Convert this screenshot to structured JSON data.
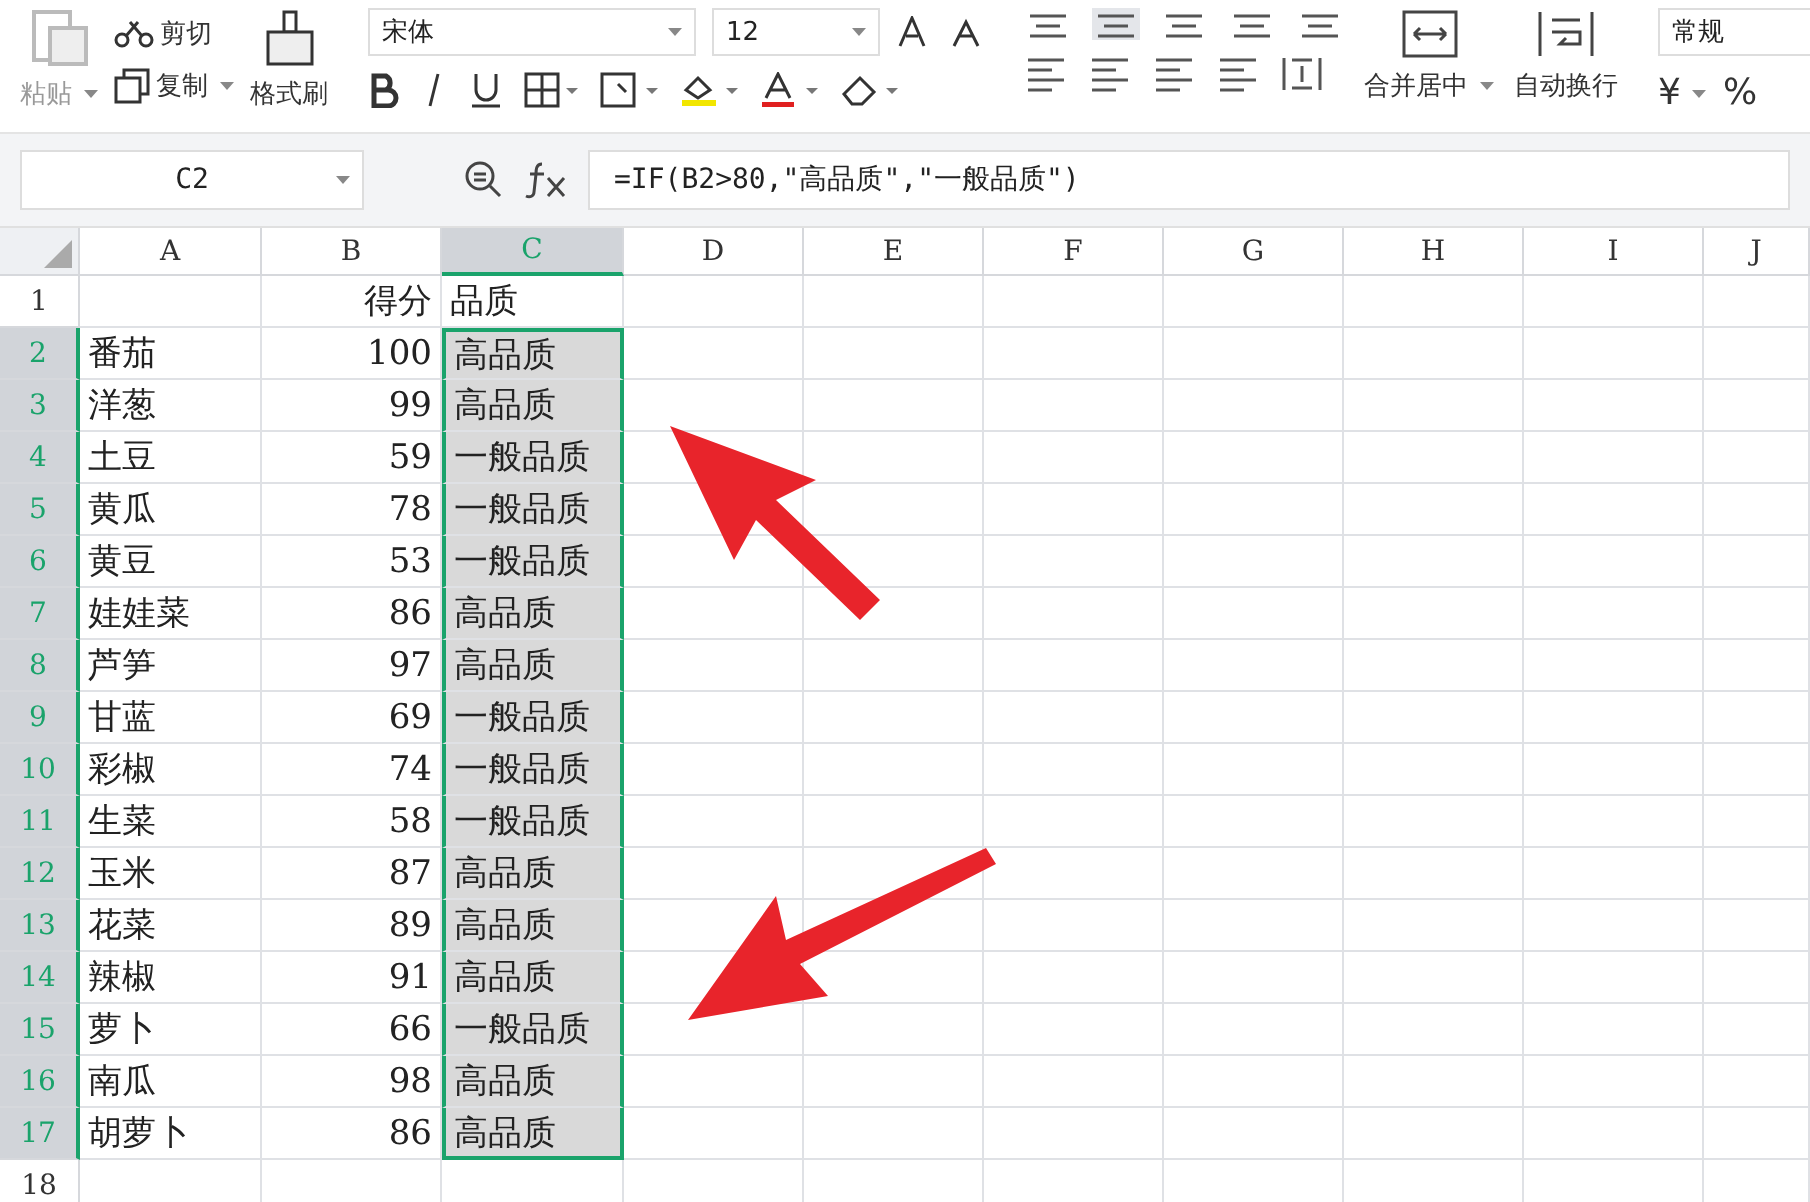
{
  "toolbar": {
    "paste": "粘贴",
    "cut": "剪切",
    "copy": "复制",
    "format_painter": "格式刷",
    "font_name": "宋体",
    "font_size": "12",
    "merge": "合并居中",
    "wrap": "自动换行",
    "number_format": "常规",
    "currency": "¥",
    "percent": "%"
  },
  "formula_bar": {
    "name_box": "C2",
    "formula": "=IF(B2>80,\"高品质\",\"一般品质\")"
  },
  "columns": [
    {
      "label": "A",
      "selected": false
    },
    {
      "label": "B",
      "selected": false
    },
    {
      "label": "C",
      "selected": true
    },
    {
      "label": "D",
      "selected": false
    },
    {
      "label": "E",
      "selected": false
    },
    {
      "label": "F",
      "selected": false
    },
    {
      "label": "G",
      "selected": false
    },
    {
      "label": "H",
      "selected": false
    },
    {
      "label": "I",
      "selected": false
    },
    {
      "label": "J",
      "selected": false
    }
  ],
  "rows": [
    {
      "number": "1",
      "selected": false,
      "cells": [
        "",
        "得分",
        "品质"
      ]
    },
    {
      "number": "2",
      "selected": true,
      "cells": [
        "番茄",
        "100",
        "高品质"
      ]
    },
    {
      "number": "3",
      "selected": true,
      "cells": [
        "洋葱",
        "99",
        "高品质"
      ]
    },
    {
      "number": "4",
      "selected": true,
      "cells": [
        "土豆",
        "59",
        "一般品质"
      ]
    },
    {
      "number": "5",
      "selected": true,
      "cells": [
        "黄瓜",
        "78",
        "一般品质"
      ]
    },
    {
      "number": "6",
      "selected": true,
      "cells": [
        "黄豆",
        "53",
        "一般品质"
      ]
    },
    {
      "number": "7",
      "selected": true,
      "cells": [
        "娃娃菜",
        "86",
        "高品质"
      ]
    },
    {
      "number": "8",
      "selected": true,
      "cells": [
        "芦笋",
        "97",
        "高品质"
      ]
    },
    {
      "number": "9",
      "selected": true,
      "cells": [
        "甘蓝",
        "69",
        "一般品质"
      ]
    },
    {
      "number": "10",
      "selected": true,
      "cells": [
        "彩椒",
        "74",
        "一般品质"
      ]
    },
    {
      "number": "11",
      "selected": true,
      "cells": [
        "生菜",
        "58",
        "一般品质"
      ]
    },
    {
      "number": "12",
      "selected": true,
      "cells": [
        "玉米",
        "87",
        "高品质"
      ]
    },
    {
      "number": "13",
      "selected": true,
      "cells": [
        "花菜",
        "89",
        "高品质"
      ]
    },
    {
      "number": "14",
      "selected": true,
      "cells": [
        "辣椒",
        "91",
        "高品质"
      ]
    },
    {
      "number": "15",
      "selected": true,
      "cells": [
        "萝卜",
        "66",
        "一般品质"
      ]
    },
    {
      "number": "16",
      "selected": true,
      "cells": [
        "南瓜",
        "98",
        "高品质"
      ]
    },
    {
      "number": "17",
      "selected": true,
      "cells": [
        "胡萝卜",
        "86",
        "高品质"
      ]
    },
    {
      "number": "18",
      "selected": false,
      "cells": [
        "",
        "",
        ""
      ]
    }
  ]
}
